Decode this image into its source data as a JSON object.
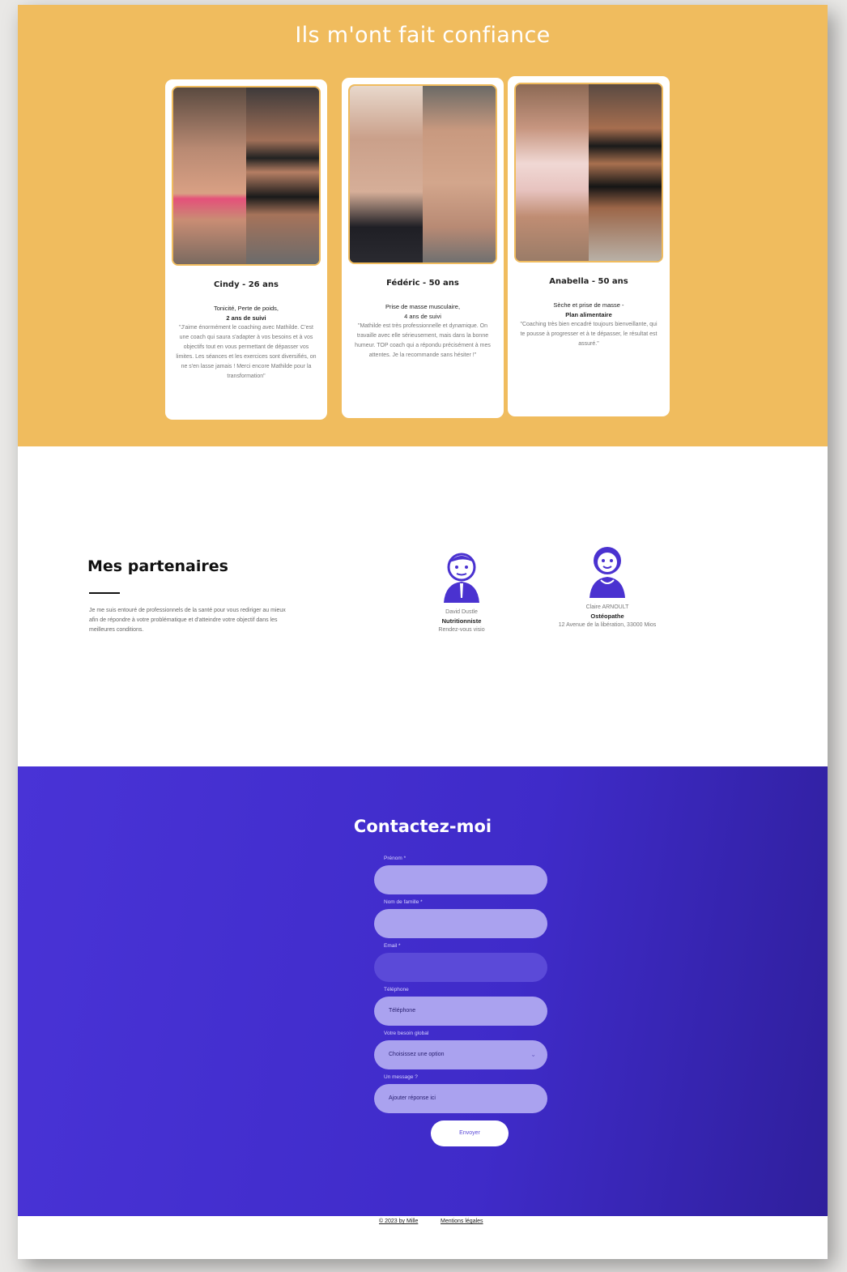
{
  "testimonials": {
    "title": "Ils m'ont fait confiance",
    "cards": [
      {
        "name": "Cindy - 26 ans",
        "goal": "Tonicité, Perte de poids,",
        "duration": "2 ans de suivi",
        "quote": "\"J'aime énormément le coaching avec Mathilde. C'est une coach qui saura s'adapter à vos besoins et à vos objectifs tout en vous permettant de dépasser vos limites. Les séances et les exercices sont diversifiés, on ne s'en lasse jamais ! Merci encore Mathilde pour la transformation\""
      },
      {
        "name": "Fédéric - 50 ans",
        "goal": "Prise de masse musculaire,",
        "duration": "4 ans de suivi",
        "quote": "\"Mathilde est très professionnelle et dynamique. On travaille avec elle sérieusement, mais dans la bonne humeur. TOP coach qui a répondu précisément à mes attentes. Je la recommande sans hésiter !\""
      },
      {
        "name": "Anabella - 50 ans",
        "goal": "Sèche et prise de masse -",
        "duration": "Plan alimentaire",
        "quote": "\"Coaching très bien encadré toujours bienveillante, qui te pousse à progresser et à te dépasser, le résultat est assuré.\""
      }
    ]
  },
  "partners": {
    "title": "Mes partenaires",
    "description": "Je me suis entouré de professionnels de la santé pour vous rediriger au mieux afin de répondre à votre problématique et d'atteindre votre objectif dans les meilleures conditions.",
    "items": [
      {
        "name": "David Dustle",
        "role": "Nutritionniste",
        "extra": "Rendez-vous visio"
      },
      {
        "name": "Claire ARNOULT",
        "role": "Ostéopathe",
        "extra": "12 Avenue de la libération, 33000 Mios"
      }
    ]
  },
  "contact": {
    "title": "Contactez-moi",
    "fields": [
      {
        "label": "Prénom *",
        "placeholder": ""
      },
      {
        "label": "Nom de famille *",
        "placeholder": ""
      },
      {
        "label": "Email *",
        "placeholder": ""
      },
      {
        "label": "Téléphone",
        "placeholder": "Téléphone"
      },
      {
        "label": "Votre besoin global",
        "placeholder": "Choisissez une option"
      },
      {
        "label": "Un message ?",
        "placeholder": "Ajouter réponse ici"
      }
    ],
    "send_label": "Envoyer"
  },
  "footer": {
    "copyright": "© 2023 by Mille",
    "legal": "Mentions légales"
  },
  "colors": {
    "testimonial_bg": "#f0bc5e",
    "contact_bg": "#4933d6",
    "input_bg": "#aaa2ef",
    "partner_icon": "#4a32d0"
  }
}
